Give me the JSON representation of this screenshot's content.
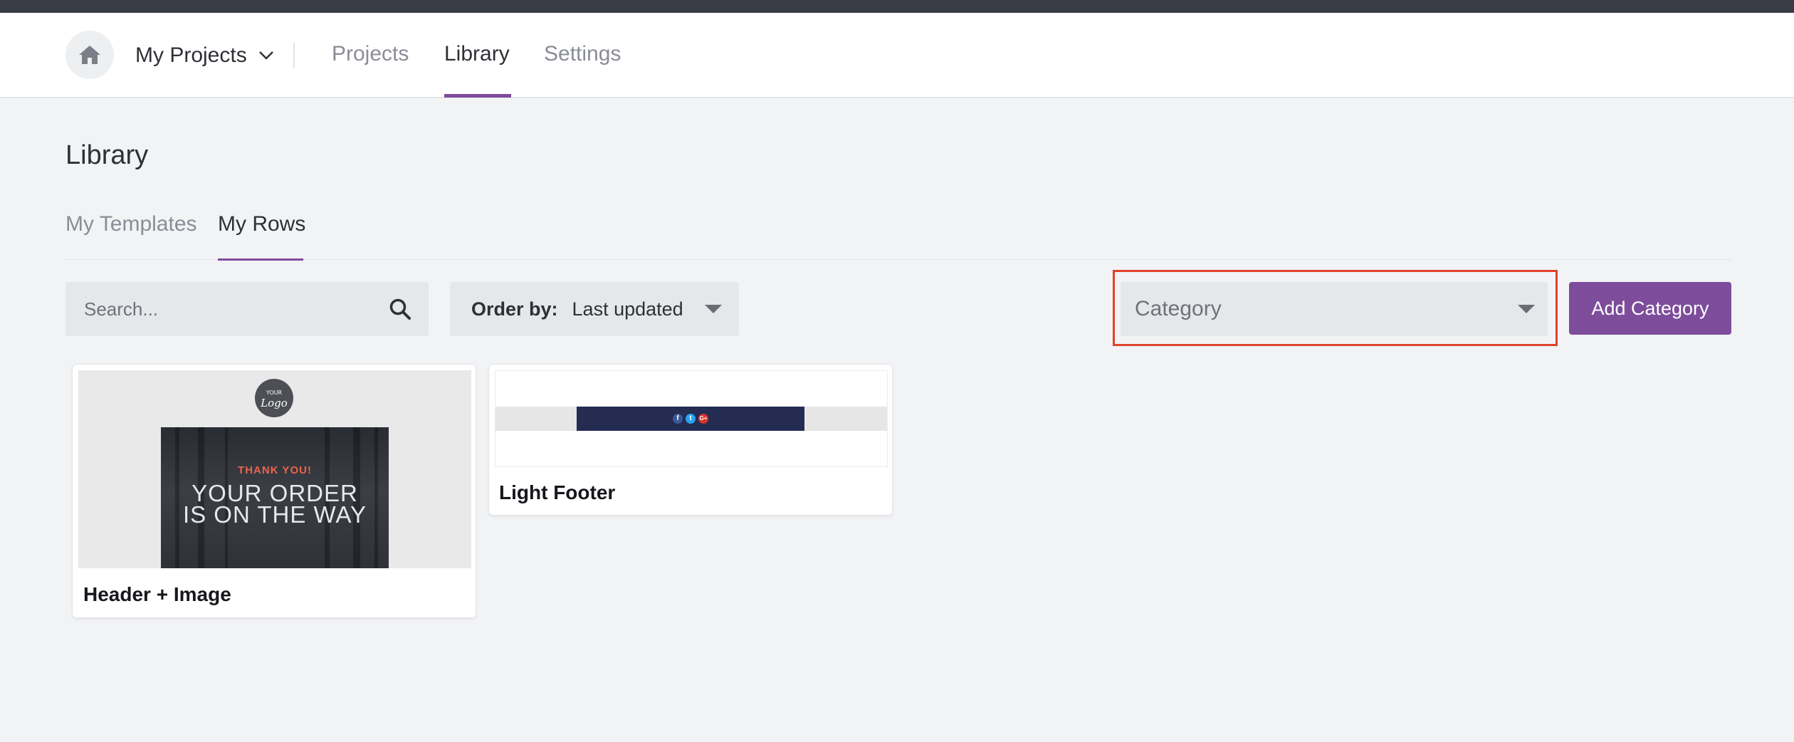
{
  "header": {
    "project_switcher": "My Projects",
    "nav": [
      {
        "label": "Projects"
      },
      {
        "label": "Library"
      },
      {
        "label": "Settings"
      }
    ]
  },
  "page": {
    "title": "Library",
    "tabs": [
      {
        "label": "My Templates"
      },
      {
        "label": "My Rows"
      }
    ]
  },
  "toolbar": {
    "search_placeholder": "Search...",
    "order_label": "Order by:",
    "order_value": "Last updated",
    "category_placeholder": "Category",
    "add_category_label": "Add Category"
  },
  "cards": [
    {
      "title": "Header + Image",
      "thumbnail": {
        "logo_top": "YOUR",
        "logo_main": "Logo",
        "hero_sub": "THANK YOU!",
        "hero_line1": "YOUR ORDER",
        "hero_line2": "IS ON THE WAY"
      }
    },
    {
      "title": "Light Footer",
      "thumbnail": {
        "social": [
          {
            "icon": "facebook-icon",
            "glyph": "f",
            "color": "#3b5998"
          },
          {
            "icon": "twitter-icon",
            "glyph": "t",
            "color": "#2aa3ef"
          },
          {
            "icon": "google-plus-icon",
            "glyph": "G+",
            "color": "#d6322a"
          }
        ]
      }
    }
  ],
  "colors": {
    "accent": "#7d4c9b",
    "highlight_border": "#e0422d",
    "topbar": "#3a3c45"
  }
}
